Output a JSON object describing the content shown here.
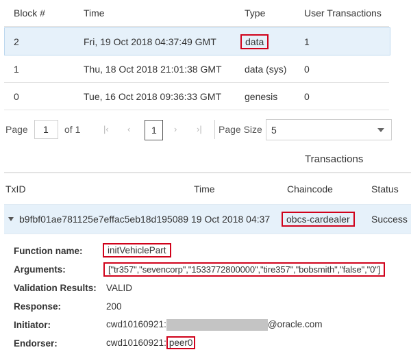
{
  "blocks": {
    "headers": [
      "Block #",
      "Time",
      "Type",
      "User Transactions"
    ],
    "rows": [
      {
        "block": "2",
        "time": "Fri, 19 Oct 2018 04:37:49 GMT",
        "type": "data",
        "tx": "1"
      },
      {
        "block": "1",
        "time": "Thu, 18 Oct 2018 21:01:38 GMT",
        "type": "data (sys)",
        "tx": "0"
      },
      {
        "block": "0",
        "time": "Tue, 16 Oct 2018 09:36:33 GMT",
        "type": "genesis",
        "tx": "0"
      }
    ]
  },
  "pager": {
    "page_label": "Page",
    "page_value": "1",
    "of_label": "of 1",
    "current": "1",
    "page_size_label": "Page Size",
    "page_size_value": "5",
    "icons": [
      "first-page-icon",
      "prev-page-icon",
      "next-page-icon",
      "last-page-icon"
    ]
  },
  "transactions": {
    "title": "Transactions",
    "headers": [
      "TxID",
      "Time",
      "Chaincode",
      "Status"
    ],
    "row": {
      "txid": "b9fbf01ae781125e7effac5eb18d195089",
      "time": "19 Oct 2018 04:37",
      "chaincode": "obcs-cardealer",
      "status": "Success"
    }
  },
  "details": {
    "function_label": "Function name:",
    "function_value": "initVehiclePart",
    "arguments_label": "Arguments:",
    "arguments_value": "[\"tr357\",\"sevencorp\",\"1533772800000\",\"tire357\",\"bobsmith\",\"false\",\"0\"]",
    "validation_label": "Validation Results:",
    "validation_value": "VALID",
    "response_label": "Response:",
    "response_value": "200",
    "initiator_label": "Initiator:",
    "initiator_prefix": "cwd10160921:",
    "initiator_suffix": "@oracle.com",
    "endorser_label": "Endorser:",
    "endorser_prefix": "cwd10160921:",
    "endorser_value": "peer0"
  },
  "colors": {
    "highlight_box": "#d0021b",
    "selected_row": "#e6f1fa"
  }
}
